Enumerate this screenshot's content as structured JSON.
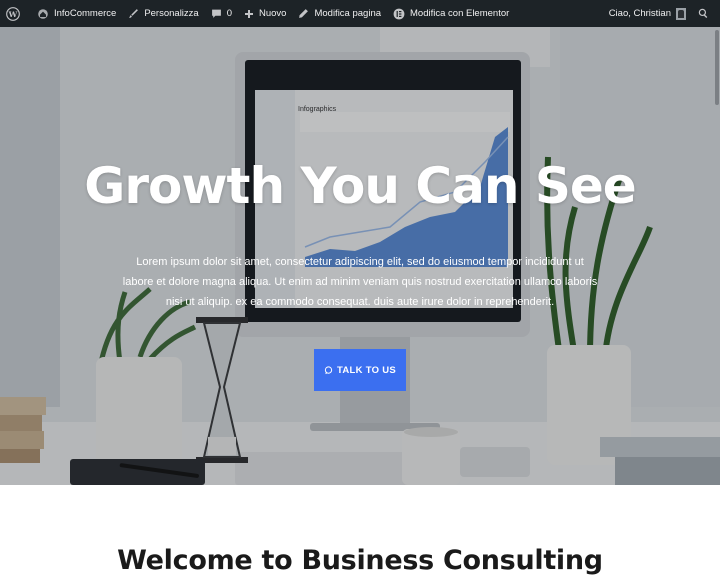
{
  "adminbar": {
    "site_name": "InfoCommerce",
    "customize": "Personalizza",
    "comments_count": "0",
    "new": "Nuovo",
    "edit_page": "Modifica pagina",
    "edit_elementor": "Modifica con Elementor",
    "greeting": "Ciao, Christian"
  },
  "hero": {
    "title": "Growth You Can See",
    "text": "Lorem ipsum dolor sit amet, consectetur adipiscing elit, sed do eiusmod tempor incididunt ut labore et dolore magna aliqua. Ut enim ad minim veniam quis nostrud exercitation ullamco laboris nisi ut aliquip. ex ea commodo consequat. duis aute irure dolor in reprehenderit.",
    "cta_label": "TALK TO US",
    "screen_title": "Infographics"
  },
  "section": {
    "heading": "Welcome to Business Consulting"
  },
  "colors": {
    "adminbar_bg": "#1d2327",
    "accent": "#3b6ff0"
  }
}
